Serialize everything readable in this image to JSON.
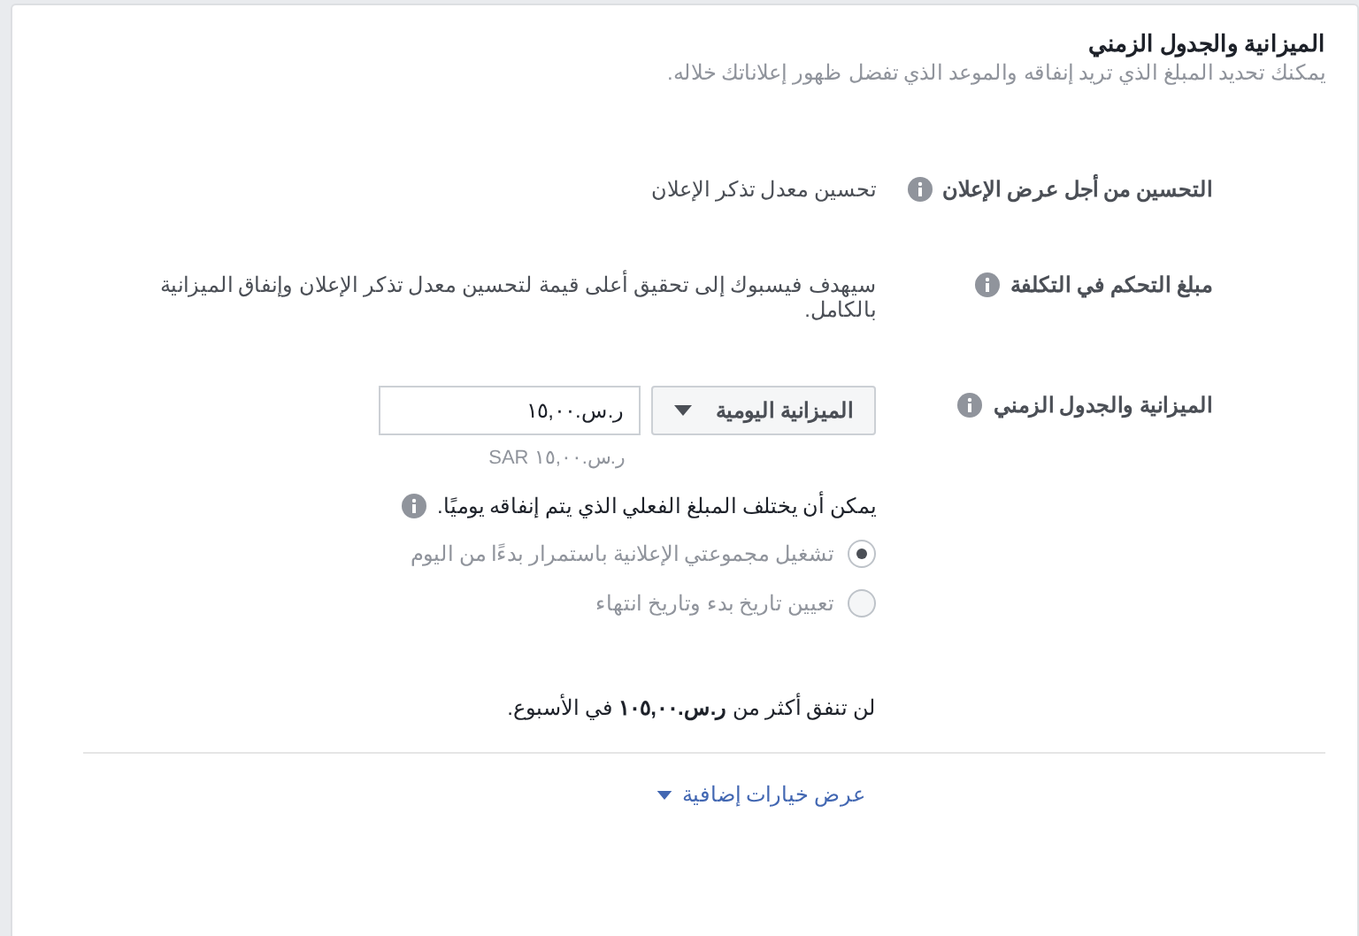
{
  "section": {
    "title": "الميزانية والجدول الزمني",
    "subtitle": "يمكنك تحديد المبلغ الذي تريد إنفاقه والموعد الذي تفضل ظهور إعلاناتك خلاله."
  },
  "rows": [
    {
      "label": "التحسين من أجل عرض الإعلان",
      "value": "تحسين معدل تذكر الإعلان"
    },
    {
      "label": "مبلغ التحكم في التكلفة",
      "value": "سيهدف فيسبوك إلى تحقيق أعلى قيمة لتحسين معدل تذكر الإعلان وإنفاق الميزانية بالكامل."
    }
  ],
  "budget": {
    "label": "الميزانية والجدول الزمني",
    "dropdown": "الميزانية اليومية",
    "amount": "ر.س.١٥,٠٠",
    "amount_hint": "ر.س.١٥,٠٠ SAR",
    "note": "يمكن أن يختلف المبلغ الفعلي الذي يتم إنفاقه يوميًا.",
    "schedule": [
      {
        "label": "تشغيل مجموعتي الإعلانية باستمرار بدءًا من اليوم",
        "selected": true
      },
      {
        "label": "تعيين تاريخ بدء وتاريخ انتهاء",
        "selected": false
      }
    ],
    "weekly": "لن تنفق أكثر من **ر.س.١٠٥,٠٠** في الأسبوع."
  },
  "more_link": "عرض خيارات إضافية"
}
